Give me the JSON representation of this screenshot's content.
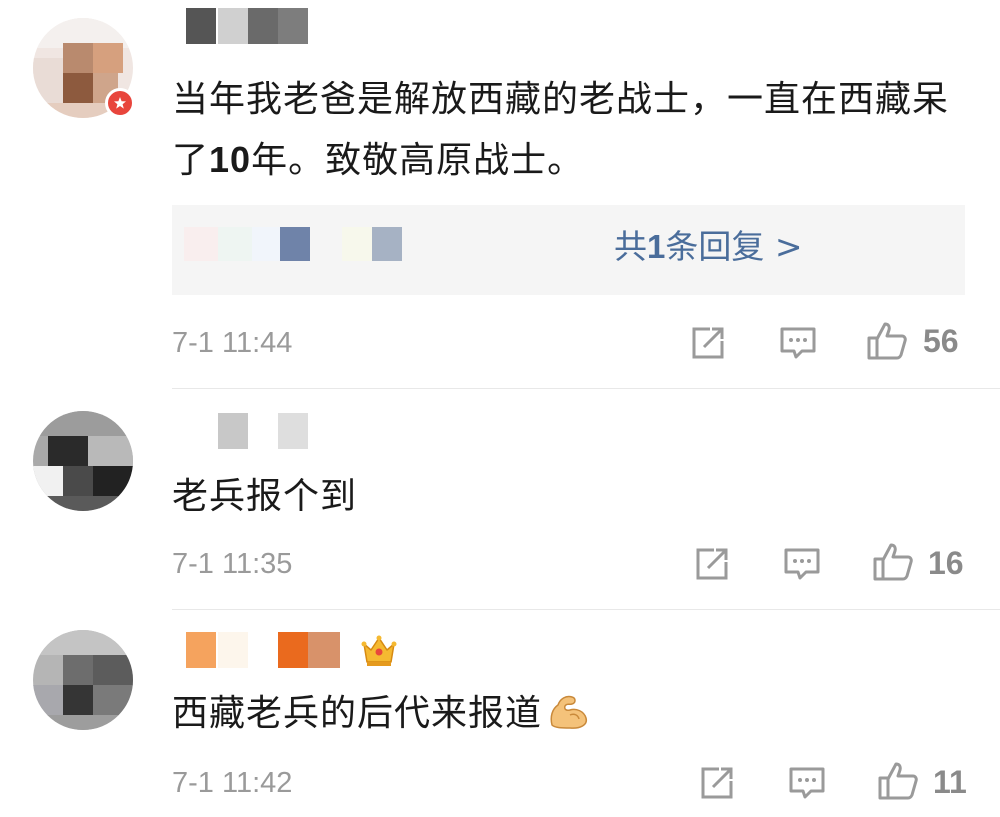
{
  "comments": [
    {
      "text": "当年我老爸是解放西藏的老战士，一直在西藏呆了",
      "text_num": "10",
      "text_tail": "年。致敬高原战士。",
      "reply_prefix": "共",
      "reply_count": "1",
      "reply_suffix": "条回复 >",
      "time": "7-1 11:44",
      "likes": "56",
      "avatar_badge": true
    },
    {
      "text": "老兵报个到",
      "time": "7-1 11:35",
      "likes": "16"
    },
    {
      "text": "西藏老兵的后代来报道",
      "emoji_name": "flexed-biceps-emoji",
      "time": "7-1 11:42",
      "likes": "11",
      "vip_crown": true
    }
  ],
  "icons": {
    "share": "share-icon",
    "comment": "comment-icon",
    "like": "thumbs-up-icon",
    "badge": "verified-badge-icon",
    "crown": "crown-icon"
  },
  "colors": {
    "link": "#4a6d9b",
    "meta": "#9a9a9a",
    "badge": "#e8453c"
  }
}
